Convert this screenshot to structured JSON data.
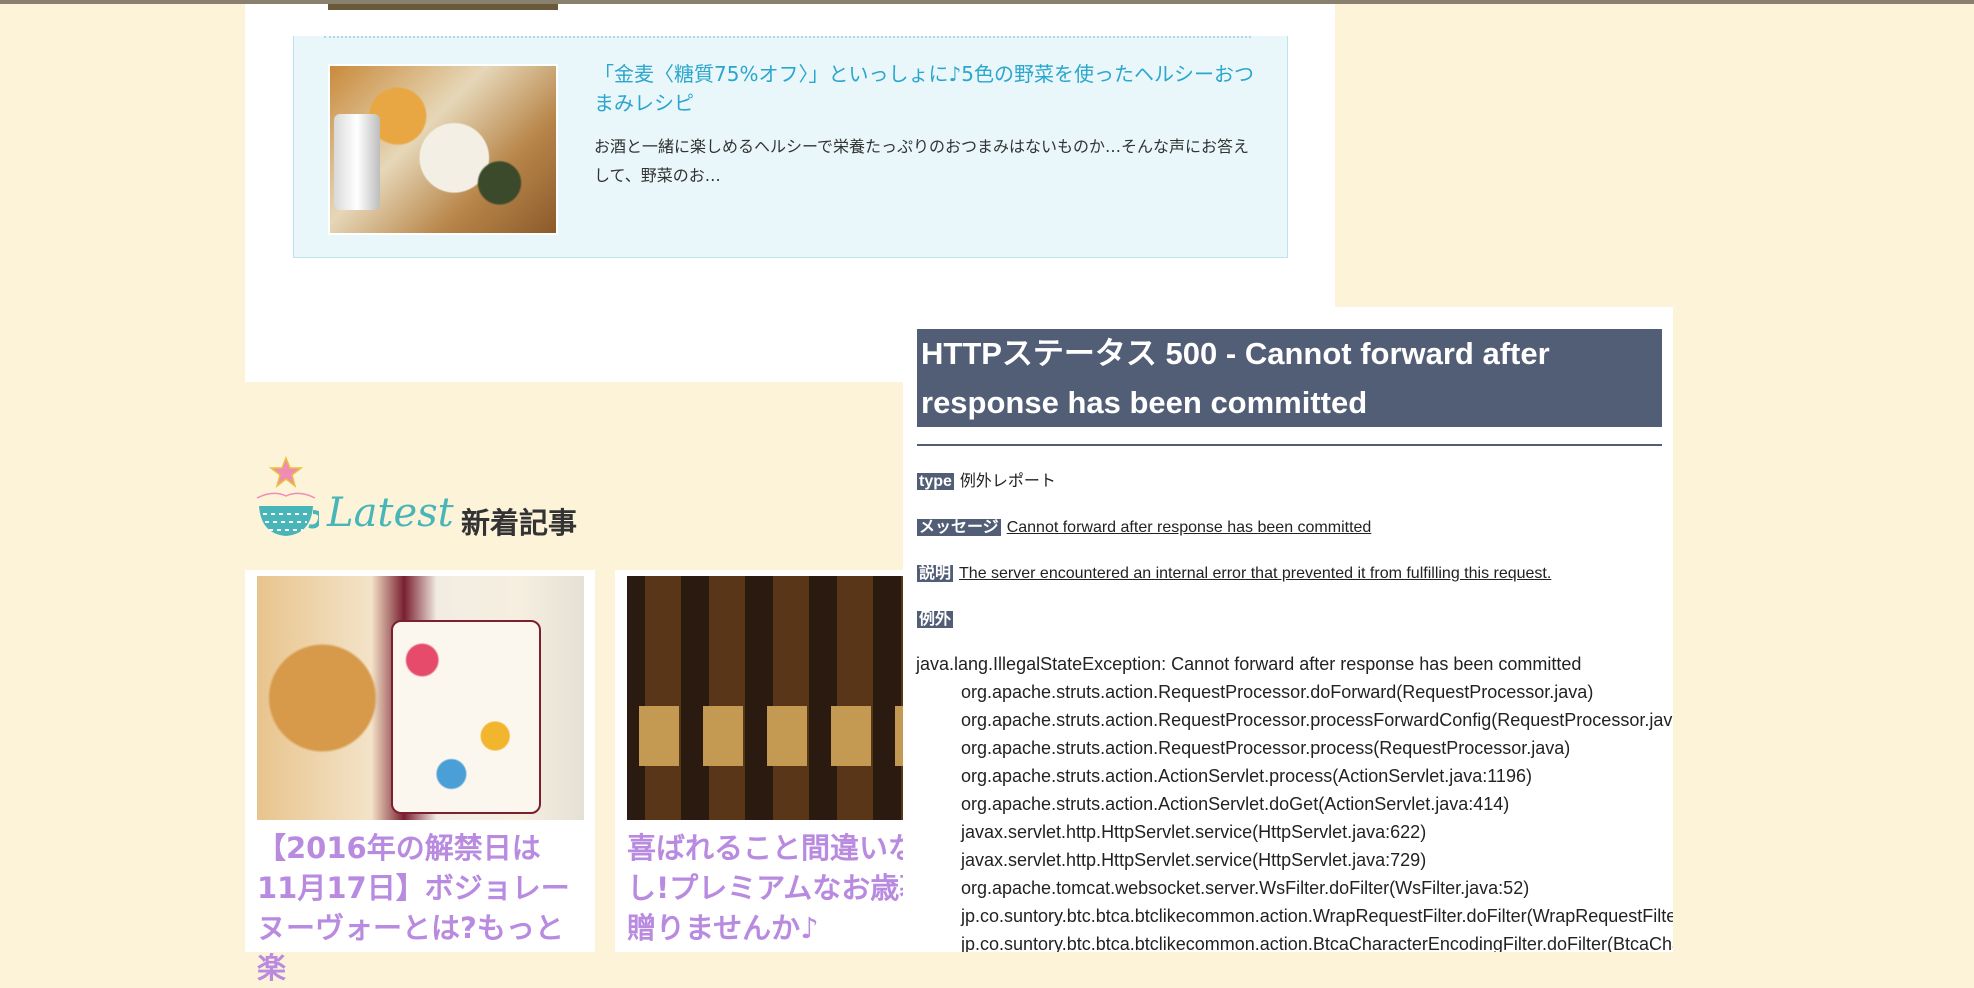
{
  "recommendation": {
    "title": "「金麦〈糖質75%オフ〉」といっしょに♪5色の野菜を使ったヘルシーおつまみレシピ",
    "description": "お酒と一緒に楽しめるヘルシーで栄養たっぷりのおつまみはないものか…そんな声にお答えして、野菜のお…"
  },
  "latest": {
    "script_label": "Latest",
    "heading": "新着記事",
    "articles": [
      {
        "title_lines": [
          "【2016年の解禁日は",
          "11月17日】ボジョレー",
          "ヌーヴォーとは?もっと楽"
        ]
      },
      {
        "title_lines": [
          "喜ばれること間違いな",
          "し!プレミアムなお歳暮",
          "贈りませんか♪"
        ]
      }
    ]
  },
  "error_page": {
    "title": "HTTPステータス 500 - Cannot forward after response has been committed",
    "type_label": "type",
    "type_value": "例外レポート",
    "message_label": "メッセージ",
    "message_value": "Cannot forward after response has been committed",
    "description_label": "説明",
    "description_value": "The server encountered an internal error that prevented it from fulfilling this request.",
    "exception_label": "例外",
    "stack_trace": [
      "java.lang.IllegalStateException: Cannot forward after response has been committed",
      "\torg.apache.struts.action.RequestProcessor.doForward(RequestProcessor.java)",
      "\torg.apache.struts.action.RequestProcessor.processForwardConfig(RequestProcessor.java)",
      "\torg.apache.struts.action.RequestProcessor.process(RequestProcessor.java)",
      "\torg.apache.struts.action.ActionServlet.process(ActionServlet.java:1196)",
      "\torg.apache.struts.action.ActionServlet.doGet(ActionServlet.java:414)",
      "\tjavax.servlet.http.HttpServlet.service(HttpServlet.java:622)",
      "\tjavax.servlet.http.HttpServlet.service(HttpServlet.java:729)",
      "\torg.apache.tomcat.websocket.server.WsFilter.doFilter(WsFilter.java:52)",
      "\tjp.co.suntory.btc.btca.btclikecommon.action.WrapRequestFilter.doFilter(WrapRequestFilter.java)",
      "\tjp.co.suntory.btc.btca.btclikecommon.action.BtcaCharacterEncodingFilter.doFilter(BtcaCharacterEncodingFilter.java)"
    ]
  },
  "colors": {
    "page_background": "#fdf3d9",
    "recommend_title": "#2ba6cc",
    "card_title": "#b98be0",
    "latest_script": "#48b6b8",
    "error_header": "#525d76"
  },
  "icons": {
    "latest_icon": "teacup-icon"
  }
}
